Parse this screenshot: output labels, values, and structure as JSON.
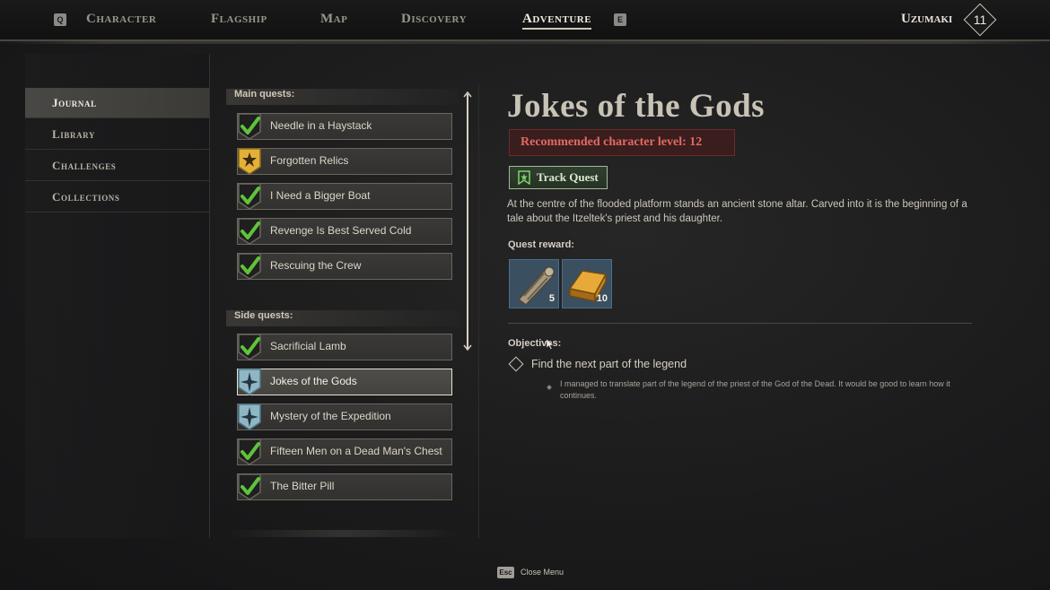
{
  "nav": {
    "left_key": "Q",
    "right_key": "E",
    "tabs": [
      {
        "label": "Character"
      },
      {
        "label": "Flagship"
      },
      {
        "label": "Map"
      },
      {
        "label": "Discovery"
      },
      {
        "label": "Adventure"
      }
    ],
    "active_tab": "Adventure",
    "player_name": "Uzumaki",
    "player_level": "11"
  },
  "sidebar": {
    "items": [
      {
        "label": "Journal"
      },
      {
        "label": "Library"
      },
      {
        "label": "Challenges"
      },
      {
        "label": "Collections"
      }
    ],
    "active": "Journal"
  },
  "quests": {
    "main_label": "Main quests:",
    "side_label": "Side quests:",
    "main": [
      {
        "label": "Needle in a Haystack",
        "status": "completed"
      },
      {
        "label": "Forgotten Relics",
        "status": "main-active"
      },
      {
        "label": "I Need a Bigger Boat",
        "status": "completed"
      },
      {
        "label": "Revenge Is Best Served Cold",
        "status": "completed"
      },
      {
        "label": "Rescuing the Crew",
        "status": "completed"
      }
    ],
    "side": [
      {
        "label": "Sacrificial Lamb",
        "status": "completed"
      },
      {
        "label": "Jokes of the Gods",
        "status": "in-progress"
      },
      {
        "label": "Mystery of the Expedition",
        "status": "in-progress"
      },
      {
        "label": "Fifteen Men on a Dead Man's Chest",
        "status": "completed"
      },
      {
        "label": "The Bitter Pill",
        "status": "completed"
      }
    ],
    "selected": "Jokes of the Gods"
  },
  "detail": {
    "title": "Jokes of the Gods",
    "recommended_level": "Recommended character level: 12",
    "track_label": "Track Quest",
    "description": "At the centre of the flooded platform stands an ancient stone altar. Carved into it is the beginning of a tale about the Itzeltek's priest and his daughter.",
    "reward_label": "Quest reward:",
    "rewards": [
      {
        "icon": "scroll-relic-icon",
        "qty": "5"
      },
      {
        "icon": "gold-ingot-icon",
        "qty": "10"
      }
    ],
    "objectives_label": "Objectives:",
    "objective": "Find the next part of the legend",
    "objective_note": "I managed to translate part of the legend of the priest of the God of the Dead. It would be good to learn how it continues."
  },
  "footer": {
    "key": "Esc",
    "label": "Close Menu"
  },
  "colors": {
    "accent_red": "#e26a63",
    "check_green": "#5ec43a",
    "track_green": "#a7b79b"
  }
}
